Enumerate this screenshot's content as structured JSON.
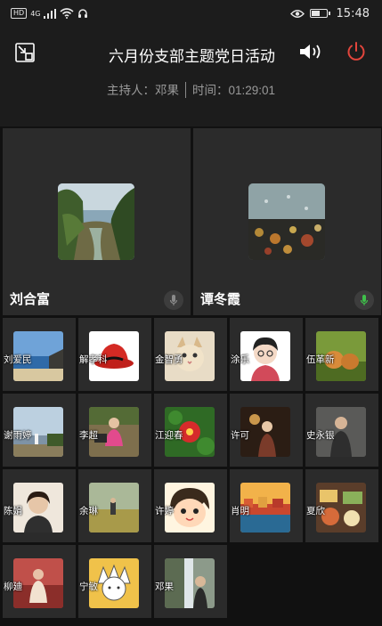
{
  "status_bar": {
    "network_badge": "HD",
    "network_type": "4G",
    "time": "15:48"
  },
  "header": {
    "title": "六月份支部主题党日活动",
    "host_label": "主持人：邓果",
    "time_label": "时间：01:29:01"
  },
  "speakers": [
    {
      "name": "刘合富",
      "mic_state": "inactive"
    },
    {
      "name": "谭冬霞",
      "mic_state": "active"
    }
  ],
  "participants": [
    {
      "name": "刘爱民"
    },
    {
      "name": "解孝科"
    },
    {
      "name": "金智勇"
    },
    {
      "name": "涂乐"
    },
    {
      "name": "伍革新"
    },
    {
      "name": "谢雨婷"
    },
    {
      "name": "李超"
    },
    {
      "name": "江迎春"
    },
    {
      "name": "许可"
    },
    {
      "name": "史永银"
    },
    {
      "name": "陈娟"
    },
    {
      "name": "余琳"
    },
    {
      "name": "许婷"
    },
    {
      "name": "肖明"
    },
    {
      "name": "夏欣"
    },
    {
      "name": "柳廸"
    },
    {
      "name": "宁敏"
    },
    {
      "name": "邓果"
    }
  ],
  "colors": {
    "background": "#111111",
    "tile": "#2b2b2b",
    "power_red": "#e2453c",
    "mic_active_green": "#3fbf4a"
  }
}
